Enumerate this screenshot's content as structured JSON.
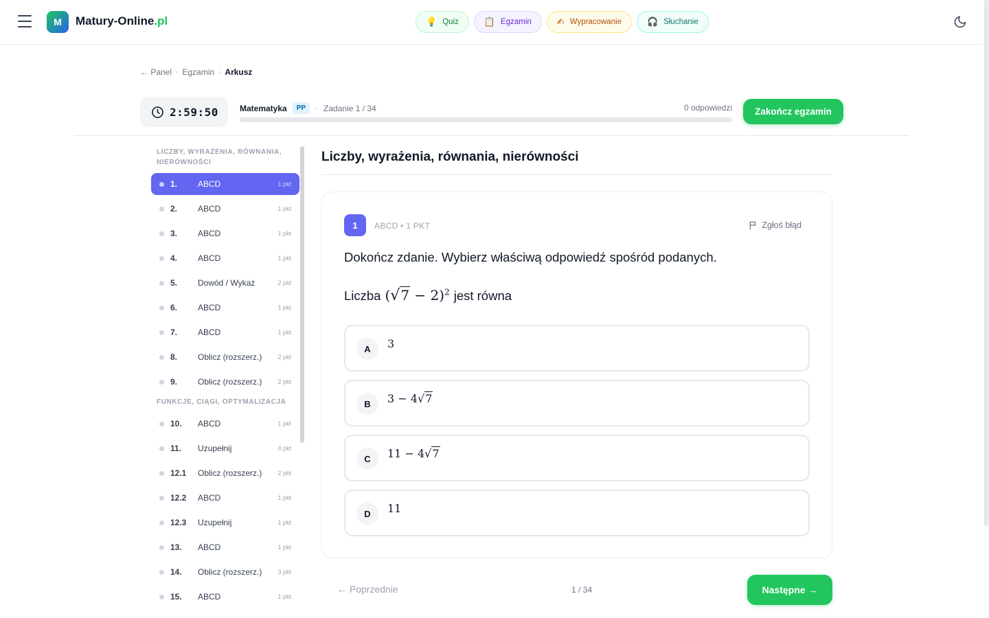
{
  "brand": {
    "logo_letter": "M",
    "name": "Matury-Online",
    "tld": ".pl",
    "accent": "#22c55e"
  },
  "nav": [
    {
      "label": "Quiz",
      "icon": "lightbulb-icon",
      "glyph": "💡"
    },
    {
      "label": "Egzamin",
      "icon": "clipboard-icon",
      "glyph": "📋"
    },
    {
      "label": "Wypracowanie",
      "icon": "writing-hand-icon",
      "glyph": "✍"
    },
    {
      "label": "Słuchanie",
      "icon": "headphones-icon",
      "glyph": "🎧"
    }
  ],
  "breadcrumb": {
    "back": "← Panel",
    "middle": "Egzamin",
    "current": "Arkusz",
    "sep": "›"
  },
  "exam": {
    "timer": "2:59:50",
    "subject": "Matematyka",
    "level": "PP",
    "dot": "·",
    "task_label": "Zadanie 1 / 34",
    "answers_count": "0 odpowiedzi",
    "progress": 0,
    "finish_label": "Zakończ egzamin"
  },
  "sidebar": {
    "sections": [
      {
        "title": "Liczby, wyrażenia, równania, nierówności",
        "items": [
          {
            "num": "1.",
            "type": "ABCD",
            "pts": "1 pkt",
            "active": true
          },
          {
            "num": "2.",
            "type": "ABCD",
            "pts": "1 pkt"
          },
          {
            "num": "3.",
            "type": "ABCD",
            "pts": "1 pkt"
          },
          {
            "num": "4.",
            "type": "ABCD",
            "pts": "1 pkt"
          },
          {
            "num": "5.",
            "type": "Dowód / Wykaż",
            "pts": "2 pkt"
          },
          {
            "num": "6.",
            "type": "ABCD",
            "pts": "1 pkt"
          },
          {
            "num": "7.",
            "type": "ABCD",
            "pts": "1 pkt"
          },
          {
            "num": "8.",
            "type": "Oblicz (rozszerz.)",
            "pts": "2 pkt"
          },
          {
            "num": "9.",
            "type": "Oblicz (rozszerz.)",
            "pts": "2 pkt"
          }
        ]
      },
      {
        "title": "Funkcje, ciągi, optymalizacja",
        "items": [
          {
            "num": "10.",
            "type": "ABCD",
            "pts": "1 pkt"
          },
          {
            "num": "11.",
            "type": "Uzupełnij",
            "pts": "4 pkt"
          },
          {
            "num": "12.1",
            "type": "Oblicz (rozszerz.)",
            "pts": "2 pkt"
          },
          {
            "num": "12.2",
            "type": "ABCD",
            "pts": "1 pkt"
          },
          {
            "num": "12.3",
            "type": "Uzupełnij",
            "pts": "1 pkt"
          },
          {
            "num": "13.",
            "type": "ABCD",
            "pts": "1 pkt"
          },
          {
            "num": "14.",
            "type": "Oblicz (rozszerz.)",
            "pts": "3 pkt"
          },
          {
            "num": "15.",
            "type": "ABCD",
            "pts": "1 pkt"
          }
        ]
      }
    ]
  },
  "main": {
    "section_heading": "Liczby, wyrażenia, równania, nierówności",
    "question": {
      "number": "1",
      "meta": "ABCD • 1 PKT",
      "report_label": "Zgłoś błąd",
      "instruction": "Dokończ zdanie. Wybierz właściwą odpowiedź spośród podanych.",
      "stem_prefix": "Liczba",
      "stem_open": "(",
      "stem_radicand": "7",
      "stem_minus": " − 2)",
      "stem_exp": "2",
      "stem_suffix": "jest równa",
      "options": [
        {
          "letter": "A",
          "text": "3",
          "radicand": ""
        },
        {
          "letter": "B",
          "text": "3 − 4",
          "radicand": "7"
        },
        {
          "letter": "C",
          "text": "11 − 4",
          "radicand": "7"
        },
        {
          "letter": "D",
          "text": "11",
          "radicand": ""
        }
      ]
    }
  },
  "footer": {
    "prev_label": "← Poprzednie",
    "page_indicator": "1 / 34",
    "next_label": "Następne →"
  }
}
